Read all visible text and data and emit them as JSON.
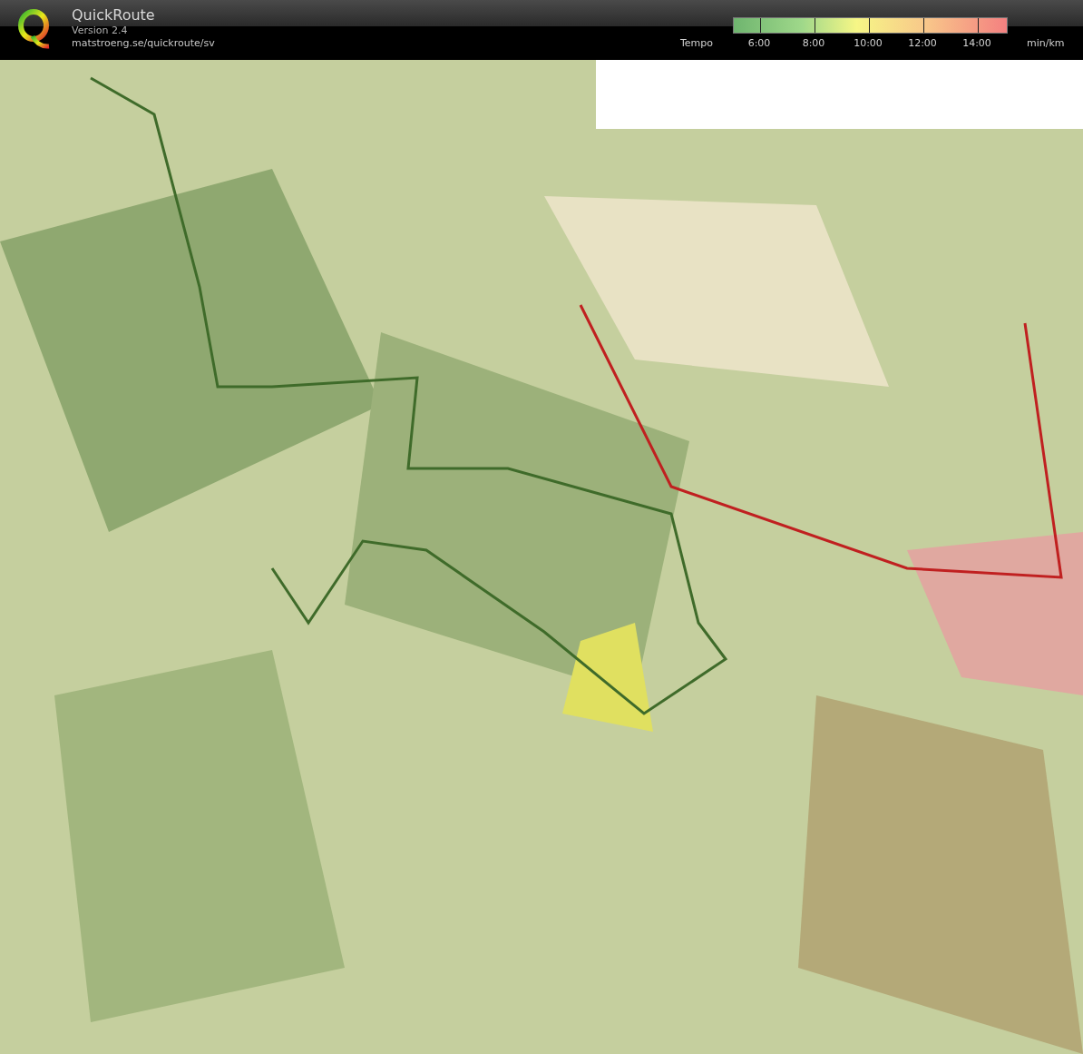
{
  "app": {
    "title": "QuickRoute",
    "version": "Version 2.4",
    "url": "matstroeng.se/quickroute/sv"
  },
  "legend": {
    "label": "Tempo",
    "ticks": [
      "6:00",
      "8:00",
      "10:00",
      "12:00",
      "14:00"
    ],
    "unit": "min/km"
  }
}
